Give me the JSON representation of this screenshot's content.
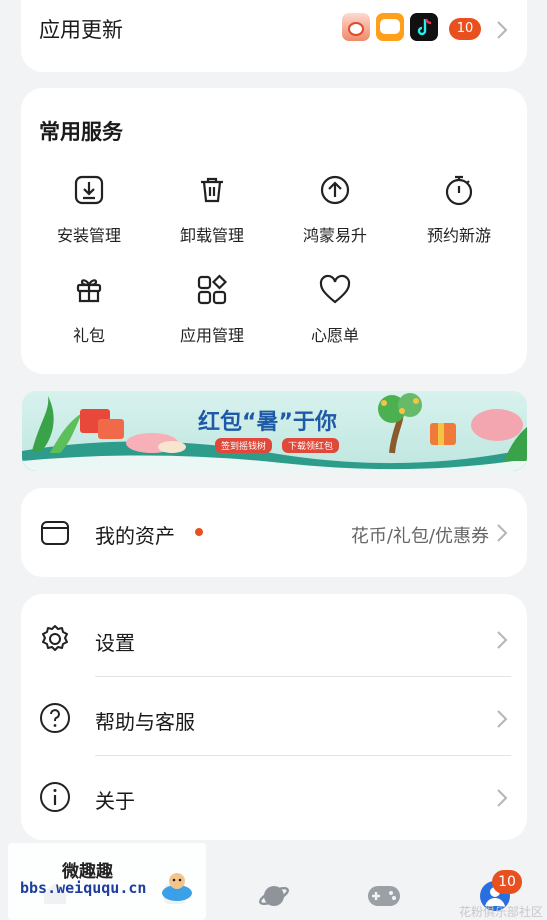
{
  "app_update": {
    "title": "应用更新",
    "count": "10",
    "app_icons": [
      "cartoon-app-icon",
      "5g-app-icon",
      "tiktok-app-icon"
    ]
  },
  "services": {
    "title": "常用服务",
    "items": [
      {
        "label": "安装管理",
        "icon": "install-icon"
      },
      {
        "label": "卸载管理",
        "icon": "trash-icon"
      },
      {
        "label": "鸿蒙易升",
        "icon": "upgrade-icon"
      },
      {
        "label": "预约新游",
        "icon": "stopwatch-icon"
      },
      {
        "label": "礼包",
        "icon": "gift-icon"
      },
      {
        "label": "应用管理",
        "icon": "app-grid-icon"
      },
      {
        "label": "心愿单",
        "icon": "heart-icon"
      }
    ]
  },
  "banner": {
    "headline": "红包“暑”于你",
    "left_tag": "签到摇钱树",
    "right_tag": "下载领红包"
  },
  "assets": {
    "label": "我的资产",
    "detail": "花币/礼包/优惠券"
  },
  "settings": {
    "items": [
      {
        "label": "设置",
        "icon": "gear-icon"
      },
      {
        "label": "帮助与客服",
        "icon": "help-icon"
      },
      {
        "label": "关于",
        "icon": "info-icon"
      }
    ]
  },
  "navbar": {
    "profile_badge": "10",
    "items": [
      "home-icon",
      "apps-icon",
      "planet-icon",
      "gamepad-icon",
      "profile-icon"
    ]
  },
  "watermark": {
    "title": "微趣趣",
    "url": "bbs.weiququ.cn",
    "corner": "花粉俱乐部社区"
  },
  "colors": {
    "accent": "#e8501f",
    "card": "#ffffff",
    "background": "#f1f3f5"
  }
}
